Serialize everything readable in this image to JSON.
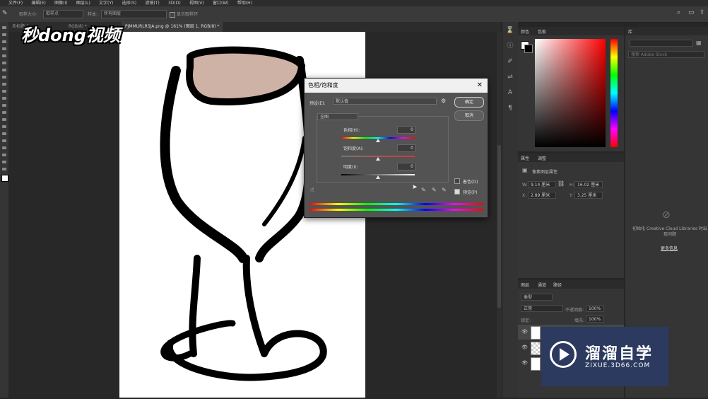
{
  "menu": [
    "文件(F)",
    "编辑(E)",
    "图像(I)",
    "图层(L)",
    "文字(Y)",
    "选择(S)",
    "滤镜(T)",
    "3D(D)",
    "视图(V)",
    "窗口(W)",
    "帮助(H)"
  ],
  "options": {
    "sample_size_label": "取样大小:",
    "sample_size_value": "取样点",
    "sample_label": "样本:",
    "sample_value": "所有图层",
    "show_ring": "显示取样环"
  },
  "tabs": {
    "tab1": "未标题-1",
    "tab2": "RGB/8) *",
    "tab3": "PJMMURLR5JA.png @ 161% (图层 1, RGB/8) *"
  },
  "watermark_top": "秒dong视频",
  "dialog": {
    "title": "色相/饱和度",
    "close": "✕",
    "preset_label": "预设(E):",
    "preset_value": "默认值",
    "ok": "确定",
    "cancel": "取消",
    "channel": "全图",
    "hue_label": "色相(H):",
    "hue_value": "0",
    "sat_label": "饱和度(A):",
    "sat_value": "0",
    "light_label": "明度(I):",
    "light_value": "0",
    "colorize": "着色(O)",
    "preview": "预览(P)"
  },
  "color_panel": {
    "tab1": "颜色",
    "tab2": "色板"
  },
  "learn_panel": {
    "tab": "库",
    "search_placeholder": "搜索 Adobe Stock"
  },
  "properties_panel": {
    "tab1": "属性",
    "tab2": "调整",
    "title": "像素图层属性",
    "w_label": "W:",
    "w_value": "9.14 厘米",
    "h_label": "H:",
    "h_value": "16.02 厘米",
    "x_label": "X:",
    "x_value": "2.89 厘米",
    "y_label": "Y:",
    "y_value": "3.25 厘米"
  },
  "cc_message": "初始化 Creative Cloud Libraries 时出现问题",
  "cc_link": "更多信息",
  "layers_panel": {
    "tab1": "图层",
    "tab2": "通道",
    "tab3": "路径",
    "filter": "类型",
    "blend": "正常",
    "opacity_label": "不透明度:",
    "opacity_value": "100%",
    "lock_label": "锁定:",
    "fill_label": "填充:",
    "fill_value": "100%"
  },
  "watermark_br": {
    "title": "溜溜自学",
    "url": "ZIXUE.3D66.COM"
  },
  "colors": {
    "accent": "#cfb2a6",
    "bg": "#262626",
    "panel": "#353535",
    "dialog": "#535353",
    "watermark": "#2b3a5e"
  }
}
